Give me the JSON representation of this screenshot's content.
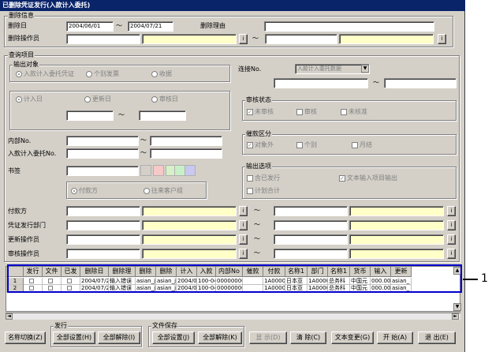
{
  "window": {
    "title": "已删除凭证发行(入款计入委托)"
  },
  "deletion_info": {
    "group_title": "删除信息",
    "date_label": "删除日",
    "date_from": "2004/06/01",
    "date_to": "2004/07/21",
    "tilde": "～",
    "reason_label": "删除理由",
    "operator_label": "删除操作员",
    "lookup_btn": "i"
  },
  "query": {
    "group_title": "查询项目",
    "output_target": {
      "title": "输出对象",
      "options": [
        "入款计入委托凭证",
        "个别发票",
        "收据"
      ]
    },
    "date_type": {
      "options": [
        "计入日",
        "更新日",
        "审核日"
      ]
    },
    "link_label": "连接No.",
    "link_select": "入款计入委托数据",
    "internal_no_label": "内部No.",
    "entry_no_label": "入款计入委托No.",
    "memo_label": "书签",
    "pay_type": {
      "options": [
        "付款方",
        "往来客户组"
      ]
    },
    "review_status": {
      "title": "审核状态",
      "options": [
        "未审核",
        "审核",
        "未核准"
      ]
    },
    "dunning": {
      "title": "催款区分",
      "options": [
        "对象外",
        "个别",
        "月结"
      ]
    },
    "output_options": {
      "title": "输出选项",
      "options": [
        "含已发行",
        "文本输入项目输出",
        "计划合计"
      ]
    },
    "range_rows": [
      "付款方",
      "凭证发行部门",
      "更新操作员",
      "审核操作员"
    ]
  },
  "colors": {
    "swatches": [
      "#ffffff",
      "#f7c8c8",
      "#d8f0c8",
      "#c8f0c8",
      "#c8c8f0"
    ]
  },
  "grid": {
    "headers": [
      "",
      "发行",
      "文件",
      "已发",
      "删除日",
      "删除理",
      "删除",
      "删除",
      "计入",
      "入款",
      "内部No",
      "催款",
      "付款",
      "名称1",
      "部门",
      "名称1",
      "货币",
      "输入",
      "更新"
    ],
    "rows": [
      [
        "1",
        "",
        "",
        "",
        "2004/07/2",
        "输入错误",
        "asian_j",
        "asian_j",
        "2004/0",
        "100-04",
        "00000000",
        "",
        "1A0000",
        "日本亚",
        "1A0000",
        "总务科",
        "中国元",
        "000.00",
        "asian_"
      ],
      [
        "2",
        "",
        "",
        "",
        "2004/07/2",
        "输入错误",
        "asian_j",
        "asian_j",
        "2004/0",
        "100-04",
        "00000000",
        "",
        "1A0000",
        "日本亚",
        "1A0000",
        "总务科",
        "中国元",
        "000.00",
        "asian_"
      ]
    ]
  },
  "footer": {
    "name_switch": "名称切换(Z)",
    "issue_group": "发行",
    "issue_set_all": "全部设置(H)",
    "issue_clear_all": "全部解除(I)",
    "file_group": "文件保存",
    "file_set_all": "全部设置(J)",
    "file_clear_all": "全部解除(K)",
    "display": "显 示(D)",
    "clear": "清 除(C)",
    "text_change": "文本变更(G)",
    "start": "开 始(A)",
    "exit": "退 出(E)"
  },
  "callout": {
    "label": "1"
  }
}
